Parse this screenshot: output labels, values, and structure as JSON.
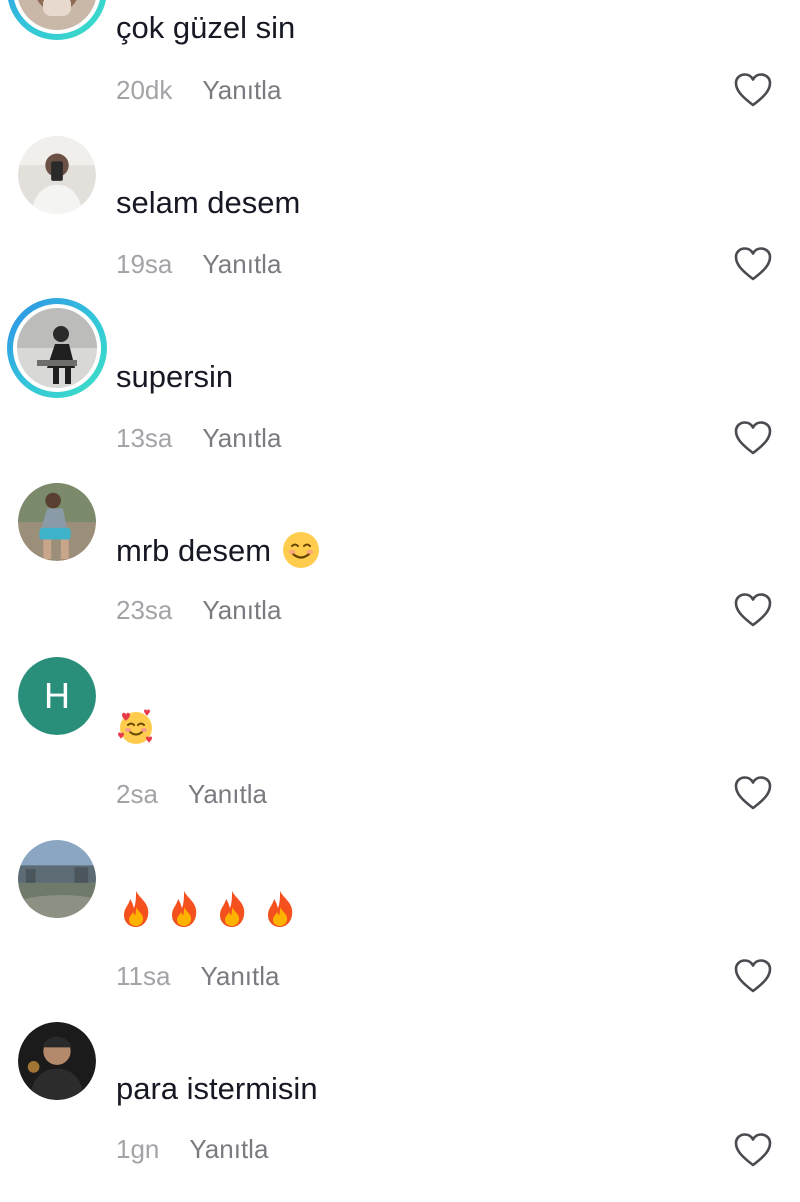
{
  "comments": [
    {
      "avatar_icon": "user-photo-avatar-icon",
      "has_story_ring": true,
      "text": "çok güzel sin",
      "emojis": [],
      "time": "20dk",
      "reply_label": "Yanıtla"
    },
    {
      "avatar_icon": "user-photo-avatar-icon",
      "has_story_ring": false,
      "text": "selam desem",
      "emojis": [],
      "time": "19sa",
      "reply_label": "Yanıtla"
    },
    {
      "avatar_icon": "user-photo-avatar-icon",
      "has_story_ring": true,
      "text": "supersin",
      "emojis": [],
      "time": "13sa",
      "reply_label": "Yanıtla"
    },
    {
      "avatar_icon": "user-photo-avatar-icon",
      "has_story_ring": false,
      "text": "mrb desem",
      "emojis": [
        "smiling-face-emoji"
      ],
      "time": "23sa",
      "reply_label": "Yanıtla"
    },
    {
      "avatar_icon": "letter-avatar-icon",
      "avatar_letter": "H",
      "avatar_color": "#2a8f7a",
      "has_story_ring": false,
      "text": "",
      "emojis": [
        "smiling-face-with-hearts-emoji"
      ],
      "time": "2sa",
      "reply_label": "Yanıtla"
    },
    {
      "avatar_icon": "landscape-photo-avatar-icon",
      "has_story_ring": false,
      "text": "",
      "emojis": [
        "fire-emoji",
        "fire-emoji",
        "fire-emoji",
        "fire-emoji"
      ],
      "time": "11sa",
      "reply_label": "Yanıtla"
    },
    {
      "avatar_icon": "user-photo-avatar-icon",
      "has_story_ring": false,
      "text": "para istermisin",
      "emojis": [],
      "time": "1gn",
      "reply_label": "Yanıtla"
    }
  ],
  "like_icon": "heart-outline-icon",
  "colors": {
    "text": "#161823",
    "time": "#a3a3a8",
    "reply": "#7a7b80",
    "story_ring_start": "#2f8fe8",
    "story_ring_end": "#3ee0c4"
  }
}
